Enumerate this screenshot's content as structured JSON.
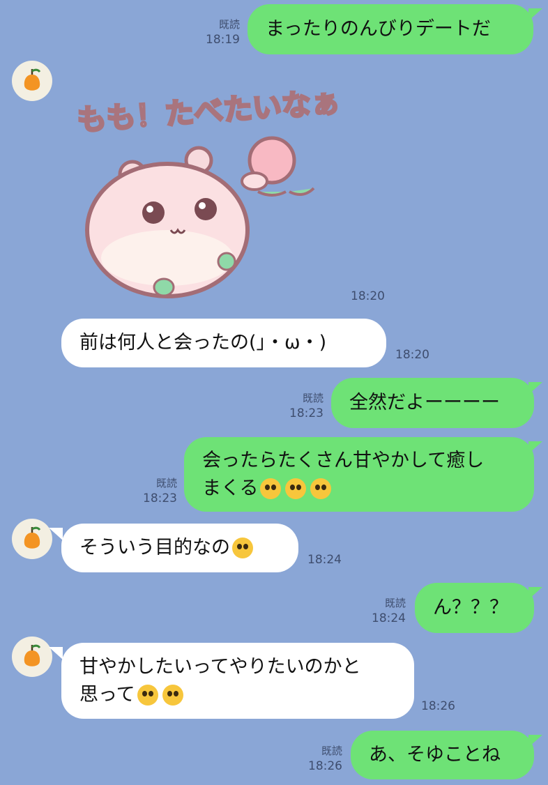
{
  "read_label": "既読",
  "messages": [
    {
      "text": "まったりのんびりデートだ",
      "time": "18:19",
      "read": true
    },
    {
      "sticker_text": "もも！たべたいなぁ",
      "time": "18:20"
    },
    {
      "text": "前は何人と会ったの(」・ω・)",
      "time": "18:20"
    },
    {
      "text": "全然だよーーーー",
      "time": "18:23",
      "read": true
    },
    {
      "line1": "会ったらたくさん甘やかして癒し",
      "line2": "まくる",
      "emojis": [
        "pleading-face",
        "pleading-face",
        "pleading-face"
      ],
      "time": "18:23",
      "read": true
    },
    {
      "text": "そういう目的なの",
      "emojis": [
        "tears-of-joy"
      ],
      "time": "18:24"
    },
    {
      "text": "ん？？？",
      "time": "18:24",
      "read": true
    },
    {
      "line1": "甘やかしたいってやりたいのかと",
      "line2": "思って",
      "emojis": [
        "tears-of-joy",
        "tears-of-joy"
      ],
      "time": "18:26"
    },
    {
      "text": "あ、そゆことね",
      "time": "18:26",
      "read": true
    }
  ],
  "colors": {
    "background": "#8aa6d6",
    "sent": "#6ee276",
    "received": "#ffffff"
  }
}
